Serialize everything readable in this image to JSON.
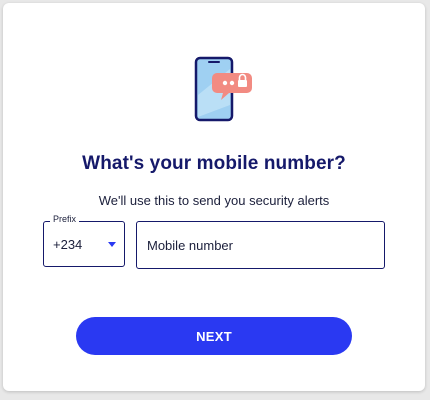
{
  "header": {
    "illustration_icon": "phone-with-locked-message-icon",
    "title": "What's your mobile number?",
    "subtitle": "We'll use this to send you security alerts"
  },
  "form": {
    "prefix": {
      "label": "Prefix",
      "value": "+234"
    },
    "mobile": {
      "placeholder": "Mobile number",
      "value": ""
    },
    "submit_label": "NEXT"
  },
  "colors": {
    "primary": "#2a39f2",
    "heading": "#15196a",
    "accent_bubble": "#f28b82",
    "phone_screen": "#9fd0f2"
  }
}
